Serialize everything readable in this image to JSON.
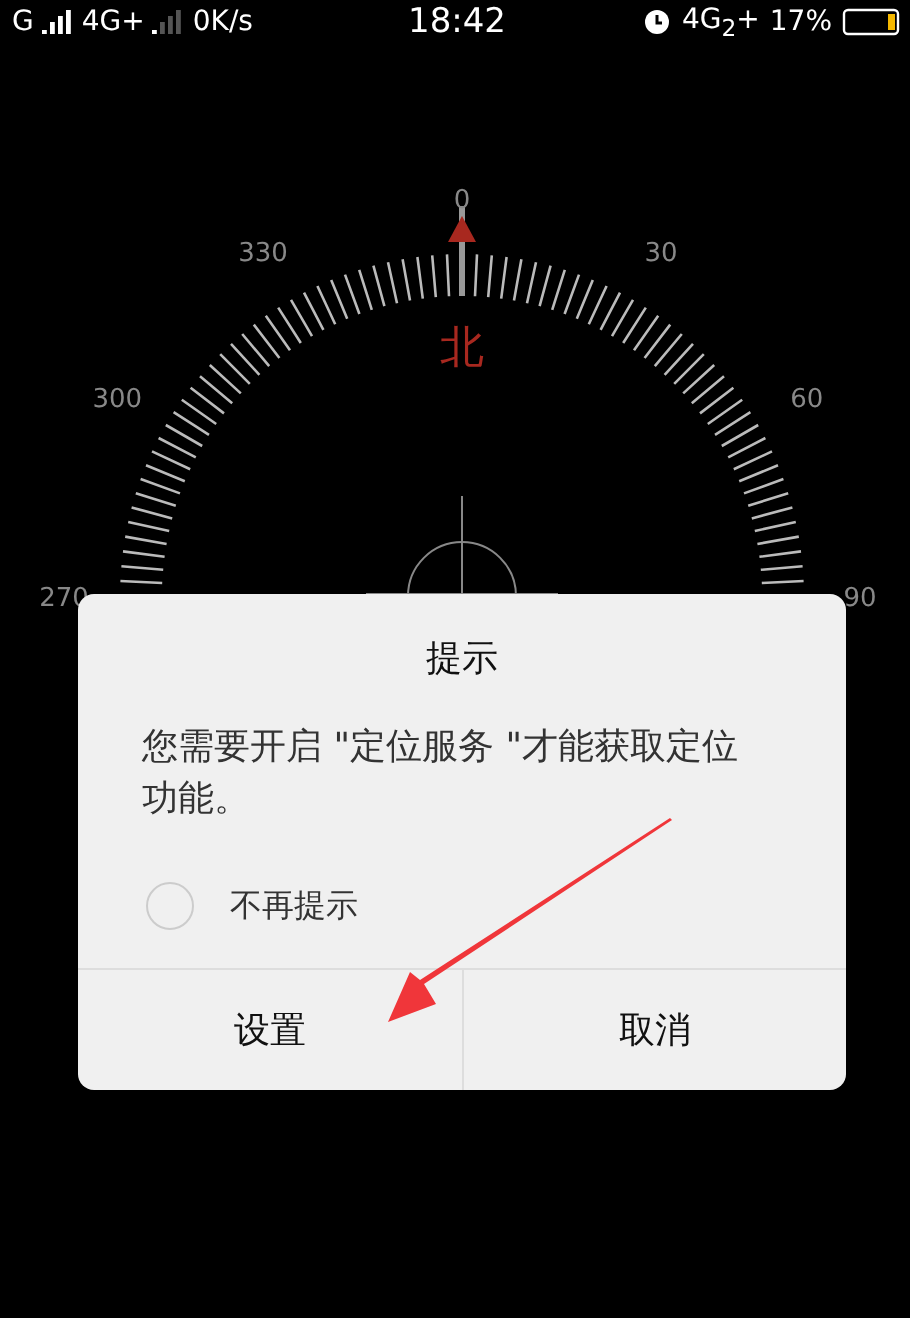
{
  "status_bar": {
    "carrier_1": "G",
    "network_1": "4G+",
    "speed": "0K/s",
    "time": "18:42",
    "network_2": "4G$_{2}$+",
    "battery": "17%"
  },
  "compass": {
    "degree_labels": [
      "0",
      "330",
      "30",
      "300",
      "60",
      "270",
      "90"
    ],
    "north_label": "北"
  },
  "dialog": {
    "title": "提示",
    "message": "您需要开启 \"定位服务 \"才能获取定位功能。",
    "checkbox": {
      "label": "不再提示",
      "checked": false
    },
    "buttons": [
      "设置",
      "取消"
    ]
  }
}
